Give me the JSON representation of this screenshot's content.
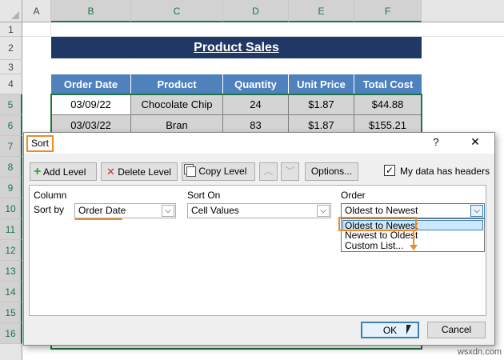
{
  "sheet": {
    "columns": [
      "A",
      "B",
      "C",
      "D",
      "E",
      "F"
    ],
    "rows": [
      "1",
      "2",
      "3",
      "4",
      "5",
      "6",
      "7",
      "8",
      "9",
      "10",
      "11",
      "12",
      "13",
      "14",
      "15",
      "16"
    ],
    "title": "Product Sales",
    "headers": [
      "Order Date",
      "Product",
      "Quantity",
      "Unit Price",
      "Total Cost"
    ],
    "data": [
      [
        "03/09/22",
        "Chocolate Chip",
        "24",
        "$1.87",
        "$44.88"
      ],
      [
        "03/03/22",
        "Bran",
        "83",
        "$1.87",
        "$155.21"
      ]
    ]
  },
  "dialog": {
    "title": "Sort",
    "help": "?",
    "close": "✕",
    "toolbar": {
      "add_level": "Add Level",
      "delete_level": "Delete Level",
      "copy_level": "Copy Level",
      "options": "Options...",
      "headers_checkbox": "My data has headers",
      "headers_checked": true
    },
    "columns": {
      "column": "Column",
      "sort_on": "Sort On",
      "order": "Order"
    },
    "row": {
      "label": "Sort by",
      "column_value": "Order Date",
      "sort_on_value": "Cell Values",
      "order_value": "Oldest to Newest"
    },
    "order_options": [
      "Oldest to Newest",
      "Newest to Oldest",
      "Custom List..."
    ],
    "ok": "OK",
    "cancel": "Cancel"
  },
  "watermark": "wsxdn.com",
  "accent": "#f08a24"
}
